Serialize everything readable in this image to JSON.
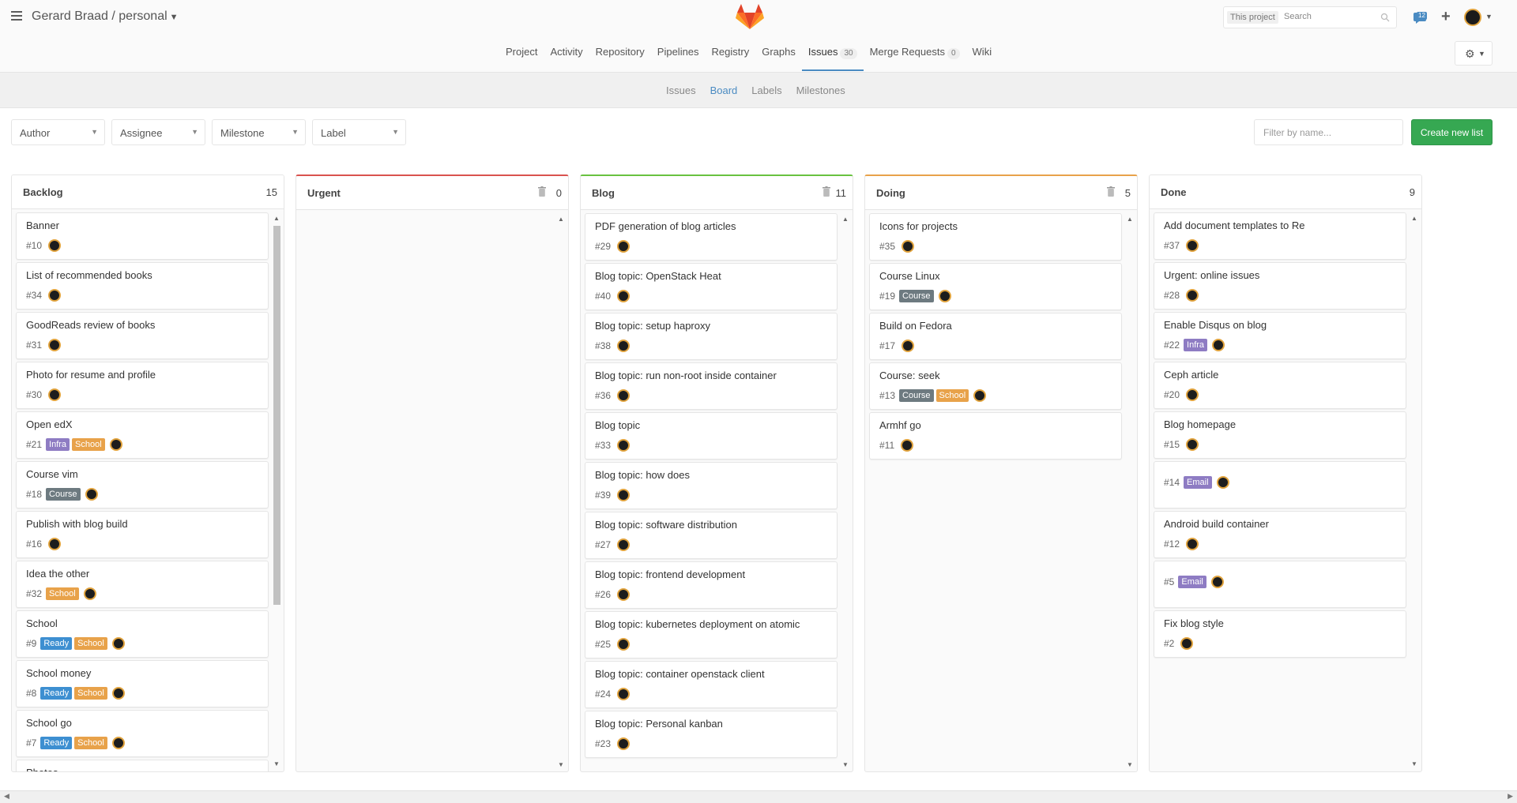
{
  "header": {
    "project_path": "Gerard Braad / personal",
    "search_scope": "This project",
    "search_placeholder": "Search",
    "todo_count": "12"
  },
  "nav": {
    "items": [
      {
        "label": "Project"
      },
      {
        "label": "Activity"
      },
      {
        "label": "Repository"
      },
      {
        "label": "Pipelines"
      },
      {
        "label": "Registry"
      },
      {
        "label": "Graphs"
      },
      {
        "label": "Issues",
        "badge": "30",
        "active": true
      },
      {
        "label": "Merge Requests",
        "badge": "0"
      },
      {
        "label": "Wiki"
      }
    ]
  },
  "subnav": {
    "items": [
      {
        "label": "Issues"
      },
      {
        "label": "Board",
        "active": true
      },
      {
        "label": "Labels"
      },
      {
        "label": "Milestones"
      }
    ]
  },
  "filters": {
    "author": "Author",
    "assignee": "Assignee",
    "milestone": "Milestone",
    "label": "Label",
    "filter_placeholder": "Filter by name...",
    "create_button": "Create new list"
  },
  "colors": {
    "infra": "#8e7cc3",
    "school": "#e8a24a",
    "course": "#6d7a80",
    "ready": "#3d8fd1",
    "email": "#8e7cc3",
    "urgent": "#d9534f",
    "blog": "#69c240",
    "doing": "#e8a24a",
    "accent": "#4a8bc2",
    "create": "#36a852"
  },
  "lists": [
    {
      "title": "Backlog",
      "count": "15",
      "color": "",
      "trash": false,
      "cards": [
        {
          "title": "Banner",
          "num": "#10",
          "labels": []
        },
        {
          "title": "List of recommended books",
          "num": "#34",
          "labels": []
        },
        {
          "title": "GoodReads review of books",
          "num": "#31",
          "labels": []
        },
        {
          "title": "Photo for resume and profile",
          "num": "#30",
          "labels": []
        },
        {
          "title": "Open edX",
          "num": "#21",
          "labels": [
            "Infra",
            "School"
          ]
        },
        {
          "title": "Course vim",
          "num": "#18",
          "labels": [
            "Course"
          ]
        },
        {
          "title": "Publish with blog build",
          "num": "#16",
          "labels": []
        },
        {
          "title": "Idea the other",
          "num": "#32",
          "labels": [
            "School"
          ]
        },
        {
          "title": "School",
          "num": "#9",
          "labels": [
            "Ready",
            "School"
          ]
        },
        {
          "title": "School money",
          "num": "#8",
          "labels": [
            "Ready",
            "School"
          ]
        },
        {
          "title": "School go",
          "num": "#7",
          "labels": [
            "Ready",
            "School"
          ]
        },
        {
          "title": "Photos",
          "num": "",
          "labels": []
        }
      ]
    },
    {
      "title": "Urgent",
      "count": "0",
      "color": "#d9534f",
      "trash": true,
      "cards": []
    },
    {
      "title": "Blog",
      "count": "11",
      "color": "#69c240",
      "trash": true,
      "cards": [
        {
          "title": "PDF generation of blog articles",
          "num": "#29",
          "labels": []
        },
        {
          "title": "Blog topic: OpenStack Heat",
          "num": "#40",
          "labels": []
        },
        {
          "title": "Blog topic: setup haproxy",
          "num": "#38",
          "labels": []
        },
        {
          "title": "Blog topic: run non-root inside container",
          "num": "#36",
          "labels": []
        },
        {
          "title": "Blog topic",
          "num": "#33",
          "labels": []
        },
        {
          "title": "Blog topic: how does",
          "num": "#39",
          "labels": []
        },
        {
          "title": "Blog topic: software distribution",
          "num": "#27",
          "labels": []
        },
        {
          "title": "Blog topic: frontend development",
          "num": "#26",
          "labels": []
        },
        {
          "title": "Blog topic: kubernetes deployment on atomic",
          "num": "#25",
          "labels": []
        },
        {
          "title": "Blog topic: container openstack client",
          "num": "#24",
          "labels": []
        },
        {
          "title": "Blog topic: Personal kanban",
          "num": "#23",
          "labels": []
        }
      ]
    },
    {
      "title": "Doing",
      "count": "5",
      "color": "#e8a24a",
      "trash": true,
      "cards": [
        {
          "title": "Icons for projects",
          "num": "#35",
          "labels": []
        },
        {
          "title": "Course Linux",
          "num": "#19",
          "labels": [
            "Course"
          ]
        },
        {
          "title": "Build on Fedora",
          "num": "#17",
          "labels": []
        },
        {
          "title": "Course: seek",
          "num": "#13",
          "labels": [
            "Course",
            "School"
          ]
        },
        {
          "title": "Armhf go",
          "num": "#11",
          "labels": []
        }
      ]
    },
    {
      "title": "Done",
      "count": "9",
      "color": "",
      "trash": false,
      "cards": [
        {
          "title": "Add document templates to Re",
          "num": "#37",
          "labels": []
        },
        {
          "title": "Urgent: online issues",
          "num": "#28",
          "labels": []
        },
        {
          "title": "Enable Disqus on blog",
          "num": "#22",
          "labels": [
            "Infra"
          ]
        },
        {
          "title": "Ceph article",
          "num": "#20",
          "labels": []
        },
        {
          "title": "Blog homepage",
          "num": "#15",
          "labels": []
        },
        {
          "title": "",
          "num": "#14",
          "labels": [
            "Email"
          ]
        },
        {
          "title": "Android build container",
          "num": "#12",
          "labels": []
        },
        {
          "title": "",
          "num": "#5",
          "labels": [
            "Email"
          ]
        },
        {
          "title": "Fix blog style",
          "num": "#2",
          "labels": []
        }
      ]
    }
  ]
}
